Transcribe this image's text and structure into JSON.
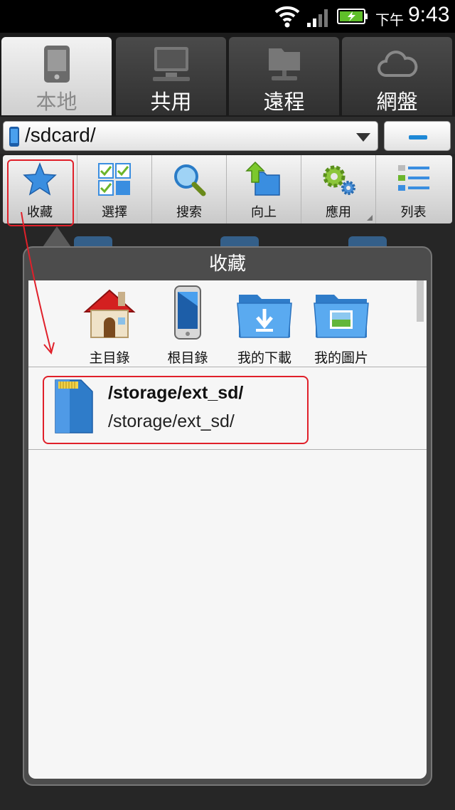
{
  "status_bar": {
    "ampm": "下午",
    "time": "9:43",
    "wifi_icon": "wifi-icon",
    "signal_icon": "signal-icon",
    "battery_icon": "battery-charging-icon"
  },
  "tabs": [
    {
      "label": "本地",
      "icon": "tablet-icon",
      "active": true
    },
    {
      "label": "共用",
      "icon": "computer-icon",
      "active": false
    },
    {
      "label": "遠程",
      "icon": "network-folder-icon",
      "active": false
    },
    {
      "label": "網盤",
      "icon": "cloud-icon",
      "active": false
    }
  ],
  "path_bar": {
    "path": "/sdcard/",
    "minus_label": "minus"
  },
  "toolbar": [
    {
      "label": "收藏",
      "icon": "star-icon"
    },
    {
      "label": "選擇",
      "icon": "select-grid-icon"
    },
    {
      "label": "搜索",
      "icon": "search-icon"
    },
    {
      "label": "向上",
      "icon": "up-folder-icon"
    },
    {
      "label": "應用",
      "icon": "gears-icon"
    },
    {
      "label": "列表",
      "icon": "list-icon"
    }
  ],
  "popup": {
    "title": "收藏",
    "quick_access": [
      {
        "label": "主目錄",
        "icon": "home-icon"
      },
      {
        "label": "根目錄",
        "icon": "phone-icon"
      },
      {
        "label": "我的下載",
        "icon": "download-folder-icon"
      },
      {
        "label": "我的圖片",
        "icon": "pictures-folder-icon"
      }
    ],
    "bookmarks": [
      {
        "title": "/storage/ext_sd/",
        "path": "/storage/ext_sd/",
        "icon": "sd-card-icon"
      }
    ]
  },
  "colors": {
    "accent_blue": "#1e88d6",
    "highlight_red": "#e0202a"
  }
}
